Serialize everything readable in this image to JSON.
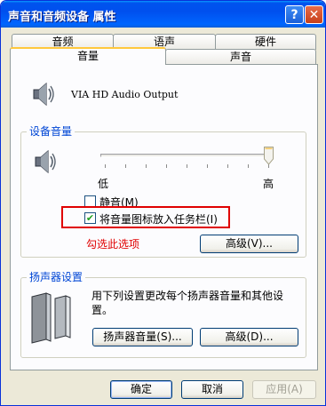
{
  "window": {
    "title": "声音和音频设备 属性",
    "help_label": "?",
    "close_label": "✕"
  },
  "tabs": {
    "row1": [
      "音频",
      "语声",
      "硬件"
    ],
    "row2": [
      "音量",
      "声音"
    ]
  },
  "device": {
    "name": "VIA HD Audio Output",
    "icon": "speaker-icon"
  },
  "device_volume": {
    "group_title": "设备音量",
    "low_label": "低",
    "high_label": "高",
    "level": 1.0,
    "mute_label": "静音(M)",
    "mute_checked": false,
    "taskbar_label": "将音量图标放入任务栏(I)",
    "taskbar_checked": true,
    "annotation": "勾选此选项",
    "advanced_label": "高级(V)..."
  },
  "speaker_settings": {
    "group_title": "扬声器设置",
    "description": "用下列设置更改每个扬声器音量和其他设置。",
    "speaker_volume_label": "扬声器音量(S)...",
    "advanced_label": "高级(D)..."
  },
  "footer": {
    "ok_label": "确定",
    "cancel_label": "取消",
    "apply_label": "应用(A)"
  },
  "colors": {
    "title_bar": "#0053ee",
    "group_title": "#0046d5",
    "highlight_border": "#e00000",
    "annotation": "#e00000",
    "check_mark": "#21a121"
  }
}
